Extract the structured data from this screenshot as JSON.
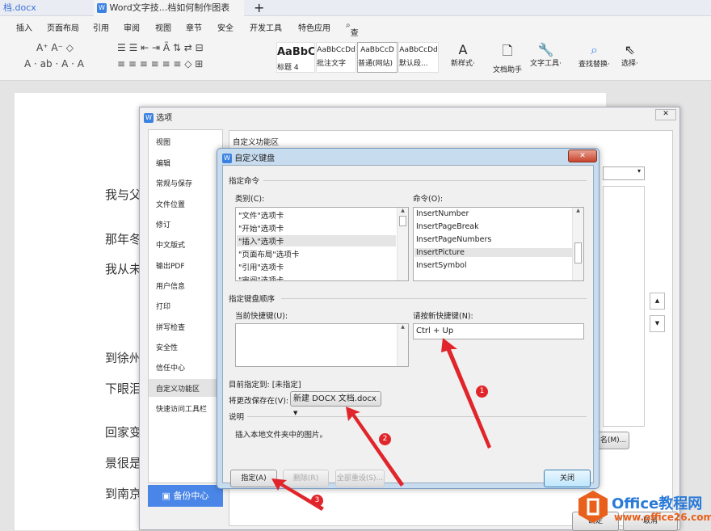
{
  "tabs": [
    {
      "label": "档.docx"
    },
    {
      "label": "Word文字技...档如何制作图表"
    }
  ],
  "new_tab": "+",
  "menu": [
    "插入",
    "页面布局",
    "引用",
    "审阅",
    "视图",
    "章节",
    "安全",
    "开发工具",
    "特色应用",
    "查找"
  ],
  "styles": [
    {
      "preview": "AaBbC",
      "label": "标题 4"
    },
    {
      "preview": "AaBbCcDd",
      "label": "批注文字"
    },
    {
      "preview": "AaBbCcD",
      "label": "普通(网站)"
    },
    {
      "preview": "AaBbCcDd",
      "label": "默认段..."
    }
  ],
  "tools": {
    "new_style": "新样式",
    "doc_assistant": "文档助手",
    "text_tools": "文字工具",
    "find_replace": "查找替换",
    "select": "选择"
  },
  "doc_lines": [
    "我与父",
    "那年冬",
    "我从未",
    "到徐州",
    "下眼泪",
    "回家变",
    "景很是",
    "到南京"
  ],
  "options": {
    "title": "选项",
    "nav": [
      "视图",
      "编辑",
      "常规与保存",
      "文件位置",
      "修订",
      "中文版式",
      "输出PDF",
      "用户信息",
      "打印",
      "拼写检查",
      "安全性",
      "信任中心",
      "自定义功能区",
      "快速访问工具栏"
    ],
    "selected": "自定义功能区",
    "backup": "备份中心",
    "section": "自定义功能区",
    "rename": "名(M)...",
    "ok": "确定",
    "cancel": "取消"
  },
  "kb": {
    "title": "自定义键盘",
    "group_cmd": "指定命令",
    "category_label": "类别(C):",
    "categories": [
      "\"文件\"选项卡",
      "\"开始\"选项卡",
      "\"插入\"选项卡",
      "\"页面布局\"选项卡",
      "\"引用\"选项卡",
      "\"审阅\"选项卡"
    ],
    "selected_category": "\"插入\"选项卡",
    "command_label": "命令(O):",
    "commands": [
      "InsertNumber",
      "InsertPageBreak",
      "InsertPageNumbers",
      "InsertPicture",
      "InsertSymbol"
    ],
    "selected_command": "InsertPicture",
    "group_keys": "指定键盘顺序",
    "current_label": "当前快捷键(U):",
    "new_label": "请按新快捷键(N):",
    "new_value": "Ctrl + Up",
    "assigned": "目前指定到: [未指定]",
    "save_label": "将更改保存在(V):",
    "save_value": "新建 DOCX 文档.docx",
    "desc_label": "说明",
    "desc": "插入本地文件夹中的图片。",
    "assign": "指定(A)",
    "delete": "删除(R)",
    "reset": "全部重设(S)...",
    "close": "关闭"
  },
  "annotations": [
    "1",
    "2",
    "3"
  ],
  "watermark": {
    "name": "Office教程网",
    "url": "www.office26.com"
  },
  "colors": {
    "accent": "#4a86e8",
    "arrow": "#e0262b",
    "logo": "#e8601c"
  }
}
